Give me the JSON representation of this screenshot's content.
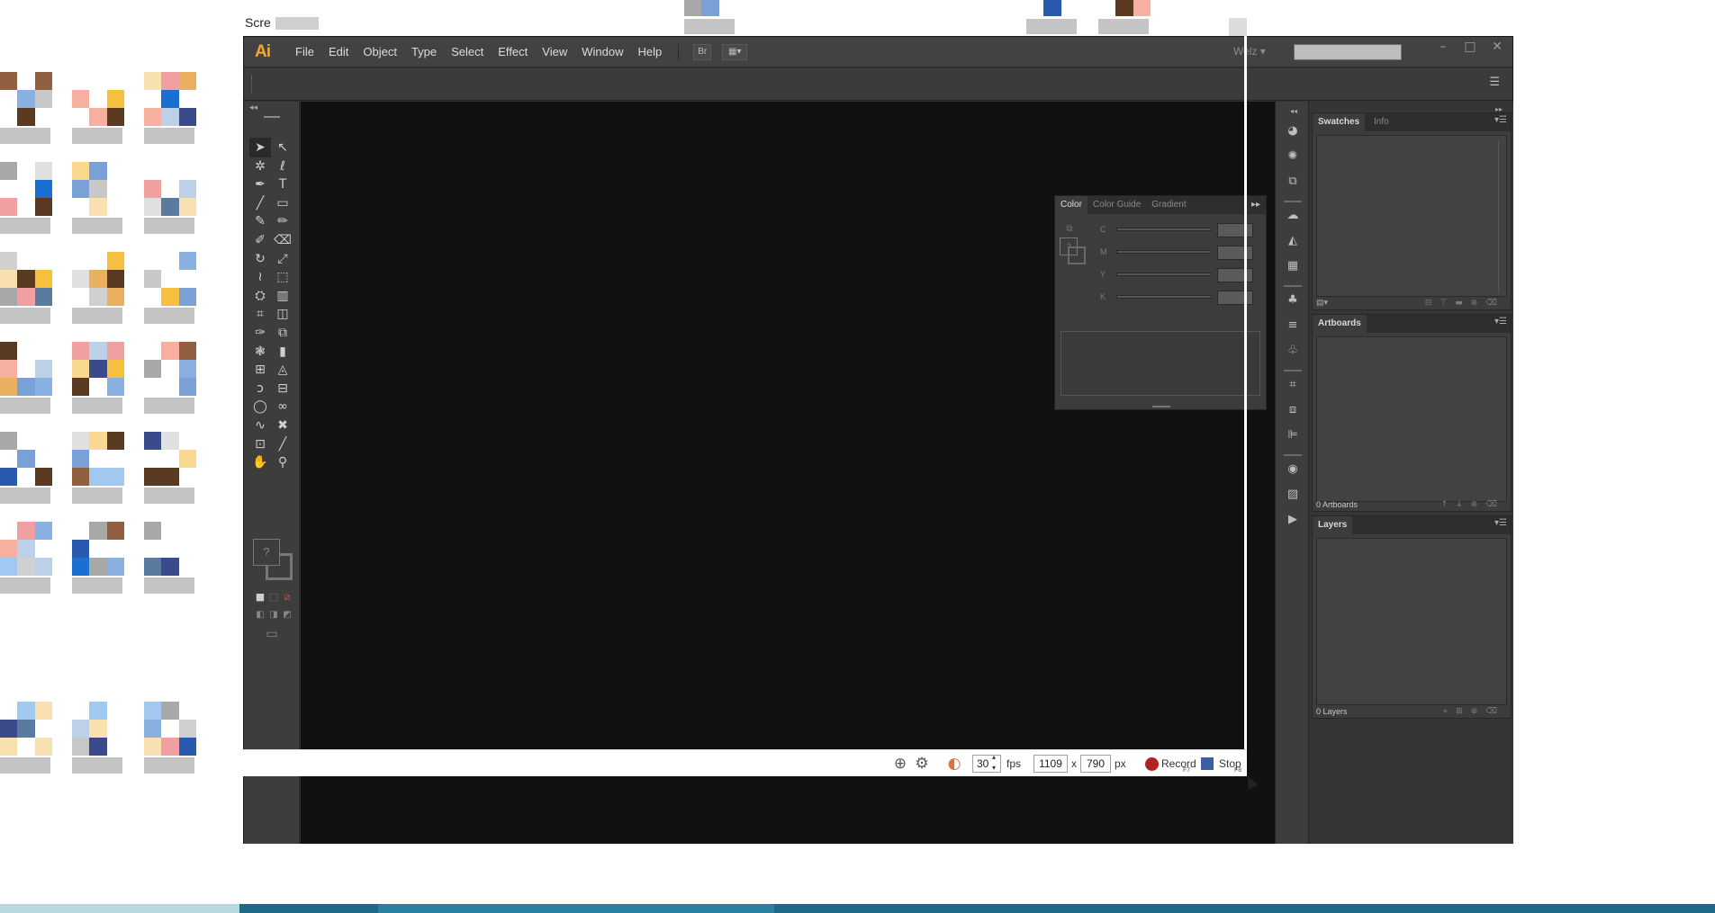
{
  "window": {
    "app_logo": "Ai",
    "menu": [
      "File",
      "Edit",
      "Object",
      "Type",
      "Select",
      "Effect",
      "View",
      "Window",
      "Help"
    ],
    "bridge_button": "Br",
    "workspace": "Welz",
    "search_placeholder": "",
    "controls": {
      "minimize": "–",
      "maximize": "□",
      "close": "✕"
    }
  },
  "color_panel": {
    "tabs": [
      "Color",
      "Color Guide",
      "Gradient"
    ],
    "channels": [
      "C",
      "M",
      "Y",
      "K"
    ]
  },
  "panels": {
    "swatches": {
      "tabs": [
        "Swatches",
        "Info"
      ]
    },
    "artboards": {
      "title": "Artboards",
      "footer": "0 Artboards"
    },
    "layers": {
      "title": "Layers",
      "footer": "0 Layers"
    }
  },
  "tools": [
    "selection-tool",
    "direct-selection-tool",
    "magic-wand-tool",
    "lasso-tool",
    "pen-tool",
    "type-tool",
    "line-tool",
    "rectangle-tool",
    "paintbrush-tool",
    "pencil-tool",
    "blob-brush-tool",
    "eraser-tool",
    "rotate-tool",
    "scale-tool",
    "width-tool",
    "free-transform-tool",
    "shape-builder-tool",
    "perspective-grid-tool",
    "mesh-tool",
    "gradient-tool",
    "eyedropper-tool",
    "blend-tool",
    "symbol-sprayer-tool",
    "column-graph-tool",
    "artboard-tool",
    "slice-tool",
    "curvature-tool",
    "measure-tool",
    "ellipse-tool",
    "infinity-tool",
    "curve-tool",
    "eraser-alt-tool",
    "artboard-alt-tool",
    "knife-tool",
    "hand-tool",
    "zoom-tool"
  ],
  "fill_stroke": {
    "fill_glyph": "?"
  },
  "recorder": {
    "title": "Scre",
    "fps": "30",
    "fps_label": "fps",
    "width": "1109",
    "times": "x",
    "height": "790",
    "unit": "px",
    "record_label": "Record",
    "record_key": "F7",
    "stop_label": "Stop",
    "stop_key": "F8"
  },
  "colors": {
    "accent": "#f5a623",
    "record": "#b22222",
    "stop": "#3b5fa0"
  }
}
